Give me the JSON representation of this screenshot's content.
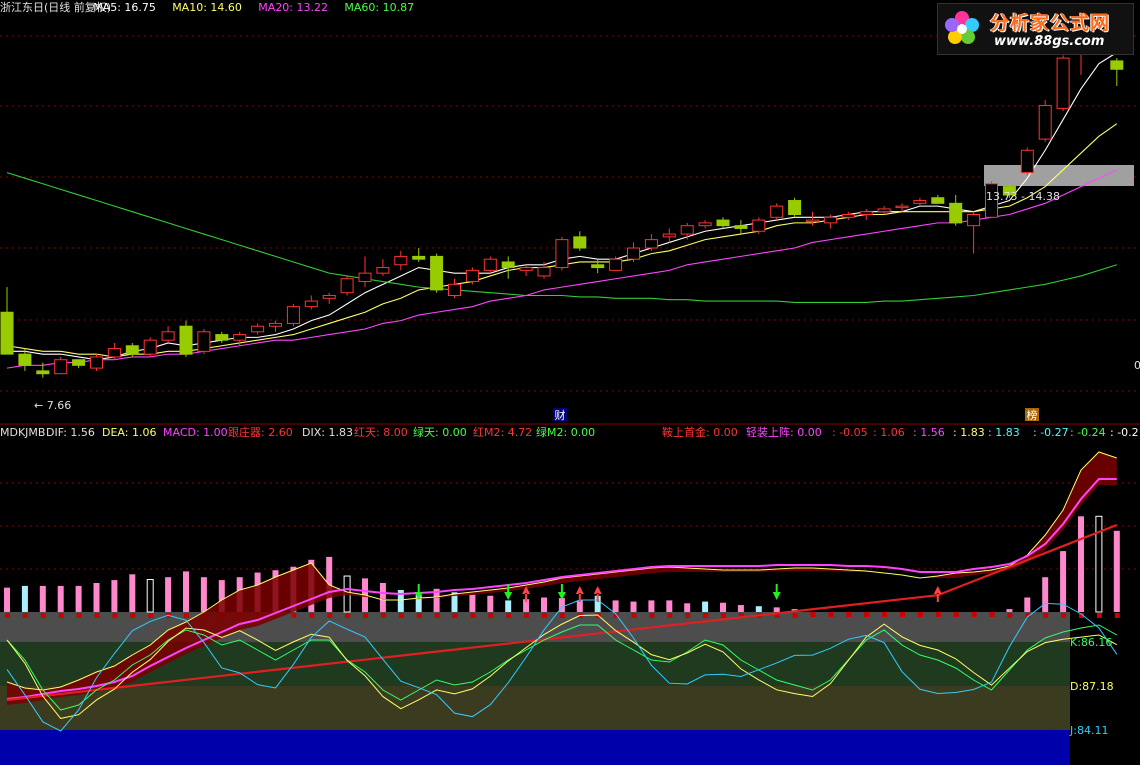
{
  "header": {
    "items": [
      {
        "text": "浙江东日(日线 前复权)",
        "color": "#e0e0e0"
      },
      {
        "text": "MA5: 16.75",
        "color": "#ffffff"
      },
      {
        "text": "MA10: 14.60",
        "color": "#ffff66"
      },
      {
        "text": "MA20: 13.22",
        "color": "#ff44ff"
      },
      {
        "text": "MA60: 10.87",
        "color": "#44ff44"
      }
    ]
  },
  "logo": {
    "title": "分析家公式网",
    "url": "www.88gs.com"
  },
  "indicator_header": {
    "items": [
      {
        "text": "MDKJMB",
        "color": "#e0e0e0"
      },
      {
        "text": "DIF: 1.56",
        "color": "#e0e0e0"
      },
      {
        "text": "DEA: 1.06",
        "color": "#ffff66"
      },
      {
        "text": "MACD: 1.00",
        "color": "#ff44ff"
      },
      {
        "text": "跟庄器: 2.60",
        "color": "#ff3333"
      },
      {
        "text": "DIX: 1.83",
        "color": "#e0e0e0"
      },
      {
        "text": "红天: 8.00",
        "color": "#ff3333"
      },
      {
        "text": "绿天: 0.00",
        "color": "#44ff44"
      },
      {
        "text": "红M2: 4.72",
        "color": "#ff3333"
      },
      {
        "text": "绿M2: 0.00",
        "color": "#44ff44"
      },
      {
        "text": "鞍上首金: 0.00",
        "color": "#ff3333"
      },
      {
        "text": "轻装上阵: 0.00",
        "color": "#ff44ff"
      },
      {
        "text": ": -0.05",
        "color": "#ff3333"
      },
      {
        "text": ": 1.06",
        "color": "#ff3333"
      },
      {
        "text": ": 1.56",
        "color": "#ff44ff"
      },
      {
        "text": ": 1.83",
        "color": "#ffff66"
      },
      {
        "text": ": 1.83",
        "color": "#44ffff"
      },
      {
        "text": ": -0.27",
        "color": "#44ffff"
      },
      {
        "text": ": -0.24",
        "color": "#44ff44"
      },
      {
        "text": ": -0.2",
        "color": "#ffffff"
      }
    ]
  },
  "annotations": {
    "low_label": "← 7.66",
    "range_label": "13.73 - 14.38",
    "marker_cai": "财",
    "marker_bang": "榜",
    "right_edge": "0"
  },
  "kdj": {
    "k": "K:86.16",
    "d": "D:87.18",
    "j": "J:84.11"
  },
  "colors": {
    "up": "#ff3333",
    "down": "#99cc00",
    "ma5": "#ffffff",
    "ma10": "#ffff66",
    "ma20": "#ff44ff",
    "ma60": "#33cc33",
    "grid": "#8b0000",
    "band_gray": "#4d4d4d",
    "band_green": "#1f3a1f",
    "band_olive": "#3b3b20",
    "band_blue": "#0000aa",
    "bar_pink": "#ff88cc",
    "bar_cyan": "#aaeeff"
  },
  "chart_data": [
    {
      "type": "candlestick",
      "title": "浙江东日(日线 前复权)",
      "ylim": [
        6.5,
        20.5
      ],
      "candles": [
        [
          10.0,
          10.9,
          8.6,
          8.5
        ],
        [
          8.5,
          8.7,
          7.9,
          8.1
        ],
        [
          7.9,
          8.2,
          7.66,
          7.8
        ],
        [
          7.8,
          8.4,
          7.8,
          8.3
        ],
        [
          8.3,
          8.3,
          8.0,
          8.1
        ],
        [
          8.0,
          8.5,
          7.9,
          8.4
        ],
        [
          8.4,
          8.9,
          8.3,
          8.7
        ],
        [
          8.8,
          8.9,
          8.4,
          8.5
        ],
        [
          8.5,
          9.1,
          8.4,
          9.0
        ],
        [
          9.0,
          9.5,
          8.9,
          9.3
        ],
        [
          9.5,
          9.7,
          8.4,
          8.5
        ],
        [
          8.6,
          9.4,
          8.5,
          9.3
        ],
        [
          9.2,
          9.3,
          8.9,
          9.0
        ],
        [
          9.0,
          9.3,
          8.8,
          9.2
        ],
        [
          9.3,
          9.6,
          9.2,
          9.5
        ],
        [
          9.5,
          9.7,
          9.3,
          9.6
        ],
        [
          9.6,
          10.3,
          9.5,
          10.2
        ],
        [
          10.2,
          10.6,
          10.1,
          10.4
        ],
        [
          10.5,
          10.7,
          10.3,
          10.6
        ],
        [
          10.7,
          11.3,
          10.6,
          11.2
        ],
        [
          11.1,
          12.0,
          10.9,
          11.4
        ],
        [
          11.4,
          11.9,
          11.3,
          11.6
        ],
        [
          11.7,
          12.2,
          11.5,
          12.0
        ],
        [
          12.0,
          12.3,
          11.8,
          11.9
        ],
        [
          12.0,
          12.1,
          10.7,
          10.8
        ],
        [
          10.6,
          11.2,
          10.5,
          11.0
        ],
        [
          11.1,
          11.6,
          11.0,
          11.5
        ],
        [
          11.5,
          12.0,
          11.4,
          11.9
        ],
        [
          11.8,
          12.0,
          11.2,
          11.6
        ],
        [
          11.5,
          11.7,
          11.3,
          11.6
        ],
        [
          11.3,
          11.8,
          11.2,
          11.6
        ],
        [
          11.6,
          12.7,
          11.5,
          12.6
        ],
        [
          12.7,
          12.9,
          12.2,
          12.3
        ],
        [
          11.7,
          11.9,
          11.4,
          11.6
        ],
        [
          11.5,
          12.0,
          11.5,
          11.9
        ],
        [
          11.9,
          12.5,
          11.8,
          12.3
        ],
        [
          12.3,
          12.8,
          12.2,
          12.6
        ],
        [
          12.7,
          13.0,
          12.5,
          12.8
        ],
        [
          12.8,
          13.2,
          12.6,
          13.1
        ],
        [
          13.1,
          13.3,
          13.0,
          13.2
        ],
        [
          13.3,
          13.4,
          13.0,
          13.1
        ],
        [
          13.1,
          13.3,
          12.8,
          13.0
        ],
        [
          12.9,
          13.4,
          12.8,
          13.3
        ],
        [
          13.4,
          13.9,
          13.3,
          13.8
        ],
        [
          14.0,
          14.1,
          13.4,
          13.5
        ],
        [
          13.3,
          13.6,
          13.1,
          13.3
        ],
        [
          13.2,
          13.5,
          13.0,
          13.4
        ],
        [
          13.4,
          13.6,
          13.3,
          13.5
        ],
        [
          13.5,
          13.7,
          13.3,
          13.6
        ],
        [
          13.6,
          13.8,
          13.5,
          13.7
        ],
        [
          13.8,
          13.9,
          13.6,
          13.8
        ],
        [
          13.9,
          14.1,
          13.8,
          14.0
        ],
        [
          14.1,
          14.2,
          13.9,
          13.9
        ],
        [
          13.9,
          14.2,
          13.1,
          13.2
        ],
        [
          13.1,
          13.6,
          12.1,
          13.5
        ],
        [
          13.4,
          14.7,
          13.4,
          14.6
        ],
        [
          14.5,
          14.6,
          14.1,
          14.2
        ],
        [
          15.0,
          15.9,
          14.9,
          15.8
        ],
        [
          16.2,
          17.6,
          16.1,
          17.4
        ],
        [
          17.3,
          19.2,
          17.2,
          19.1
        ],
        [
          19.4,
          20.1,
          18.5,
          20.0
        ],
        [
          20.1,
          20.2,
          19.5,
          19.8
        ],
        [
          19.0,
          19.1,
          18.1,
          18.7
        ]
      ],
      "ma_series": [
        {
          "name": "MA5",
          "values": [
            8.6,
            8.6,
            8.5,
            8.5,
            8.4,
            8.3,
            8.4,
            8.6,
            8.7,
            8.9,
            8.8,
            8.9,
            9.0,
            9.1,
            9.1,
            9.2,
            9.4,
            9.7,
            9.9,
            10.3,
            10.7,
            11.0,
            11.3,
            11.6,
            11.5,
            11.4,
            11.4,
            11.4,
            11.6,
            11.7,
            11.7,
            11.9,
            12.0,
            11.9,
            11.9,
            12.1,
            12.3,
            12.5,
            12.7,
            12.9,
            13.0,
            13.1,
            13.2,
            13.3,
            13.4,
            13.4,
            13.4,
            13.5,
            13.6,
            13.6,
            13.6,
            13.8,
            13.8,
            13.7,
            13.6,
            13.8,
            14.0,
            14.8,
            15.8,
            16.9,
            18.0,
            18.9,
            19.3
          ]
        },
        {
          "name": "MA10",
          "values": [
            8.8,
            8.7,
            8.6,
            8.6,
            8.5,
            8.5,
            8.4,
            8.5,
            8.5,
            8.6,
            8.6,
            8.7,
            8.8,
            8.9,
            9.0,
            9.1,
            9.2,
            9.4,
            9.6,
            9.8,
            10.0,
            10.3,
            10.5,
            10.8,
            10.9,
            11.0,
            11.1,
            11.3,
            11.5,
            11.6,
            11.6,
            11.7,
            11.8,
            11.8,
            11.8,
            11.9,
            12.1,
            12.2,
            12.4,
            12.6,
            12.7,
            12.8,
            12.9,
            13.1,
            13.2,
            13.2,
            13.3,
            13.4,
            13.5,
            13.5,
            13.6,
            13.6,
            13.6,
            13.6,
            13.6,
            13.7,
            13.8,
            14.1,
            14.5,
            15.1,
            15.7,
            16.3,
            16.75
          ]
        },
        {
          "name": "MA20",
          "values": [
            8.0,
            8.1,
            8.1,
            8.2,
            8.2,
            8.3,
            8.3,
            8.4,
            8.4,
            8.5,
            8.5,
            8.6,
            8.7,
            8.8,
            8.9,
            9.0,
            9.0,
            9.1,
            9.2,
            9.3,
            9.4,
            9.6,
            9.7,
            9.9,
            10.0,
            10.1,
            10.2,
            10.4,
            10.5,
            10.6,
            10.8,
            10.9,
            11.0,
            11.1,
            11.2,
            11.3,
            11.4,
            11.5,
            11.7,
            11.8,
            11.9,
            12.0,
            12.1,
            12.2,
            12.3,
            12.5,
            12.6,
            12.7,
            12.8,
            12.9,
            13.0,
            13.1,
            13.2,
            13.2,
            13.3,
            13.4,
            13.5,
            13.7,
            13.9,
            14.2,
            14.5,
            14.8,
            15.1
          ]
        },
        {
          "name": "MA60",
          "values": [
            15.0,
            14.8,
            14.6,
            14.4,
            14.2,
            14.0,
            13.8,
            13.6,
            13.4,
            13.2,
            13.0,
            12.8,
            12.6,
            12.4,
            12.2,
            12.0,
            11.8,
            11.6,
            11.4,
            11.3,
            11.2,
            11.1,
            11.0,
            10.9,
            10.85,
            10.8,
            10.75,
            10.7,
            10.65,
            10.6,
            10.6,
            10.6,
            10.55,
            10.55,
            10.5,
            10.5,
            10.5,
            10.45,
            10.45,
            10.4,
            10.4,
            10.4,
            10.4,
            10.4,
            10.35,
            10.35,
            10.35,
            10.35,
            10.35,
            10.4,
            10.4,
            10.45,
            10.5,
            10.55,
            10.6,
            10.7,
            10.8,
            10.9,
            11.0,
            11.15,
            11.3,
            11.5,
            11.7
          ]
        }
      ]
    },
    {
      "type": "bar",
      "title": "MDKJMB",
      "series": [
        {
          "name": "MACD",
          "values": [
            0.42,
            0.45,
            0.45,
            0.45,
            0.45,
            0.5,
            0.55,
            0.65,
            0.56,
            0.6,
            0.7,
            0.6,
            0.55,
            0.6,
            0.68,
            0.72,
            0.78,
            0.9,
            0.95,
            0.62,
            0.58,
            0.5,
            0.38,
            0.3,
            0.4,
            0.34,
            0.3,
            0.28,
            0.2,
            0.22,
            0.25,
            0.24,
            0.2,
            0.28,
            0.2,
            0.18,
            0.2,
            0.2,
            0.15,
            0.18,
            0.16,
            0.12,
            0.1,
            0.08,
            0.05,
            0.0,
            0.0,
            0.0,
            0.0,
            0.0,
            0.0,
            0.0,
            0.0,
            0.0,
            0.0,
            0.0,
            0.05,
            0.25,
            0.6,
            1.05,
            1.65,
            1.65,
            1.4
          ]
        }
      ]
    }
  ]
}
